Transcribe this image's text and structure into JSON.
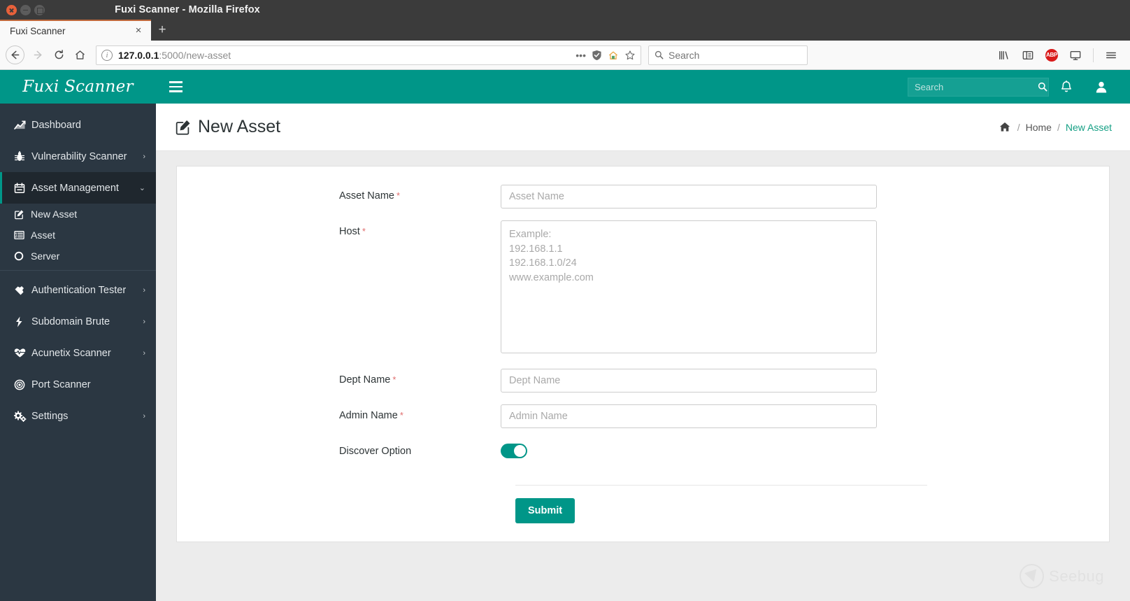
{
  "browser": {
    "window_title": "Fuxi Scanner - Mozilla Firefox",
    "tab_title": "Fuxi Scanner",
    "tab_close_label": "×",
    "newtab_label": "+",
    "url_host": "127.0.0.1",
    "url_path": ":5000/new-asset",
    "url_full": "127.0.0.1:5000/new-asset",
    "search_placeholder": "Search",
    "search_value": "",
    "more_icon": "•••",
    "icons": {
      "back": "back-arrow-icon",
      "forward": "forward-arrow-icon",
      "reload": "reload-icon",
      "home": "home-icon",
      "info": "page-info-icon",
      "shield": "tracking-protection-icon",
      "reader_home": "pocket-icon",
      "bookmark": "bookmark-star-icon",
      "library": "library-icon",
      "sidebars": "sidebars-icon",
      "adblock": "ABP",
      "screenshot": "screenshot-icon",
      "menu": "hamburger-menu-icon"
    }
  },
  "app": {
    "brand": "Fuxi Scanner",
    "accent_color": "#009688",
    "sidebar_bg": "#2b3742",
    "sidebar": {
      "items": [
        {
          "label": "Dashboard",
          "icon": "chart-line-icon",
          "caret": "",
          "active": false
        },
        {
          "label": "Vulnerability Scanner",
          "icon": "bug-icon",
          "caret": "›",
          "active": false
        },
        {
          "label": "Asset Management",
          "icon": "calendar-icon",
          "caret": "⌄",
          "active": true
        },
        {
          "label": "Authentication Tester",
          "icon": "hammer-icon",
          "caret": "›",
          "active": false
        },
        {
          "label": "Subdomain Brute",
          "icon": "bolt-icon",
          "caret": "›",
          "active": false
        },
        {
          "label": "Acunetix Scanner",
          "icon": "heartbeat-icon",
          "caret": "›",
          "active": false
        },
        {
          "label": "Port Scanner",
          "icon": "bullseye-icon",
          "caret": "",
          "active": false
        },
        {
          "label": "Settings",
          "icon": "gears-icon",
          "caret": "›",
          "active": false
        }
      ],
      "subitems": [
        {
          "label": "New Asset",
          "icon": "edit-square-icon"
        },
        {
          "label": "Asset",
          "icon": "list-icon"
        },
        {
          "label": "Server",
          "icon": "circle-o-icon"
        }
      ]
    },
    "topbar": {
      "search_placeholder": "Search",
      "search_value": "",
      "search_button_icon": "search-icon",
      "notification_icon": "bell-icon",
      "user_icon": "user-icon",
      "toggle_icon": "hamburger-menu-icon"
    },
    "page": {
      "title": "New Asset",
      "title_icon": "edit-square-icon",
      "breadcrumb": {
        "home_icon": "home-icon",
        "separator": "/",
        "items": [
          {
            "label": "Home",
            "active": false
          },
          {
            "label": "New Asset",
            "active": true
          }
        ]
      }
    },
    "form": {
      "fields": [
        {
          "label": "Asset Name",
          "required": "*",
          "type": "text",
          "placeholder": "Asset Name",
          "value": ""
        },
        {
          "label": "Host",
          "required": "*",
          "type": "textarea",
          "placeholder": "Example:\n192.168.1.1\n192.168.1.0/24\nwww.example.com",
          "value": ""
        },
        {
          "label": "Dept Name",
          "required": "*",
          "type": "text",
          "placeholder": "Dept Name",
          "value": ""
        },
        {
          "label": "Admin Name",
          "required": "*",
          "type": "text",
          "placeholder": "Admin Name",
          "value": ""
        },
        {
          "label": "Discover Option",
          "required": "",
          "type": "toggle",
          "placeholder": "",
          "value": "on"
        }
      ],
      "submit_label": "Submit"
    },
    "watermark": {
      "text": "Seebug",
      "icon": "seebug-logo-icon"
    }
  }
}
